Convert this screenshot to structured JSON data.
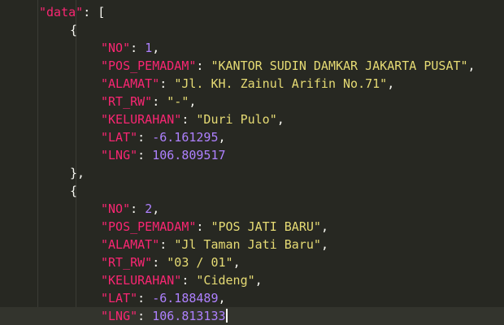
{
  "editor": {
    "root_key": "\"data\"",
    "root_open": "[",
    "records": [
      {
        "fields": [
          {
            "key": "\"NO\"",
            "value": "1",
            "type": "num",
            "trail": ","
          },
          {
            "key": "\"POS_PEMADAM\"",
            "value": "\"KANTOR SUDIN DAMKAR JAKARTA PUSAT\"",
            "type": "str",
            "trail": ","
          },
          {
            "key": "\"ALAMAT\"",
            "value": "\"Jl. KH. Zainul Arifin No.71\"",
            "type": "str",
            "trail": ","
          },
          {
            "key": "\"RT_RW\"",
            "value": "\"-\"",
            "type": "str",
            "trail": ","
          },
          {
            "key": "\"KELURAHAN\"",
            "value": "\"Duri Pulo\"",
            "type": "str",
            "trail": ","
          },
          {
            "key": "\"LAT\"",
            "value": "-6.161295",
            "type": "num",
            "trail": ","
          },
          {
            "key": "\"LNG\"",
            "value": "106.809517",
            "type": "num",
            "trail": ""
          }
        ]
      },
      {
        "fields": [
          {
            "key": "\"NO\"",
            "value": "2",
            "type": "num",
            "trail": ","
          },
          {
            "key": "\"POS_PEMADAM\"",
            "value": "\"POS JATI BARU\"",
            "type": "str",
            "trail": ","
          },
          {
            "key": "\"ALAMAT\"",
            "value": "\"Jl Taman Jati Baru\"",
            "type": "str",
            "trail": ","
          },
          {
            "key": "\"RT_RW\"",
            "value": "\"03 / 01\"",
            "type": "str",
            "trail": ","
          },
          {
            "key": "\"KELURAHAN\"",
            "value": "\"Cideng\"",
            "type": "str",
            "trail": ","
          },
          {
            "key": "\"LAT\"",
            "value": "-6.188489",
            "type": "num",
            "trail": ","
          },
          {
            "key": "\"LNG\"",
            "value": "106.813133",
            "type": "num",
            "trail": ""
          }
        ]
      }
    ],
    "object_open": "{",
    "object_close": "},",
    "colon": ": ",
    "colors": {
      "background": "#272822",
      "key": "#f92672",
      "string": "#e6db74",
      "number": "#ae81ff",
      "punctuation": "#f8f8f2",
      "current_line": "#33342d"
    }
  }
}
